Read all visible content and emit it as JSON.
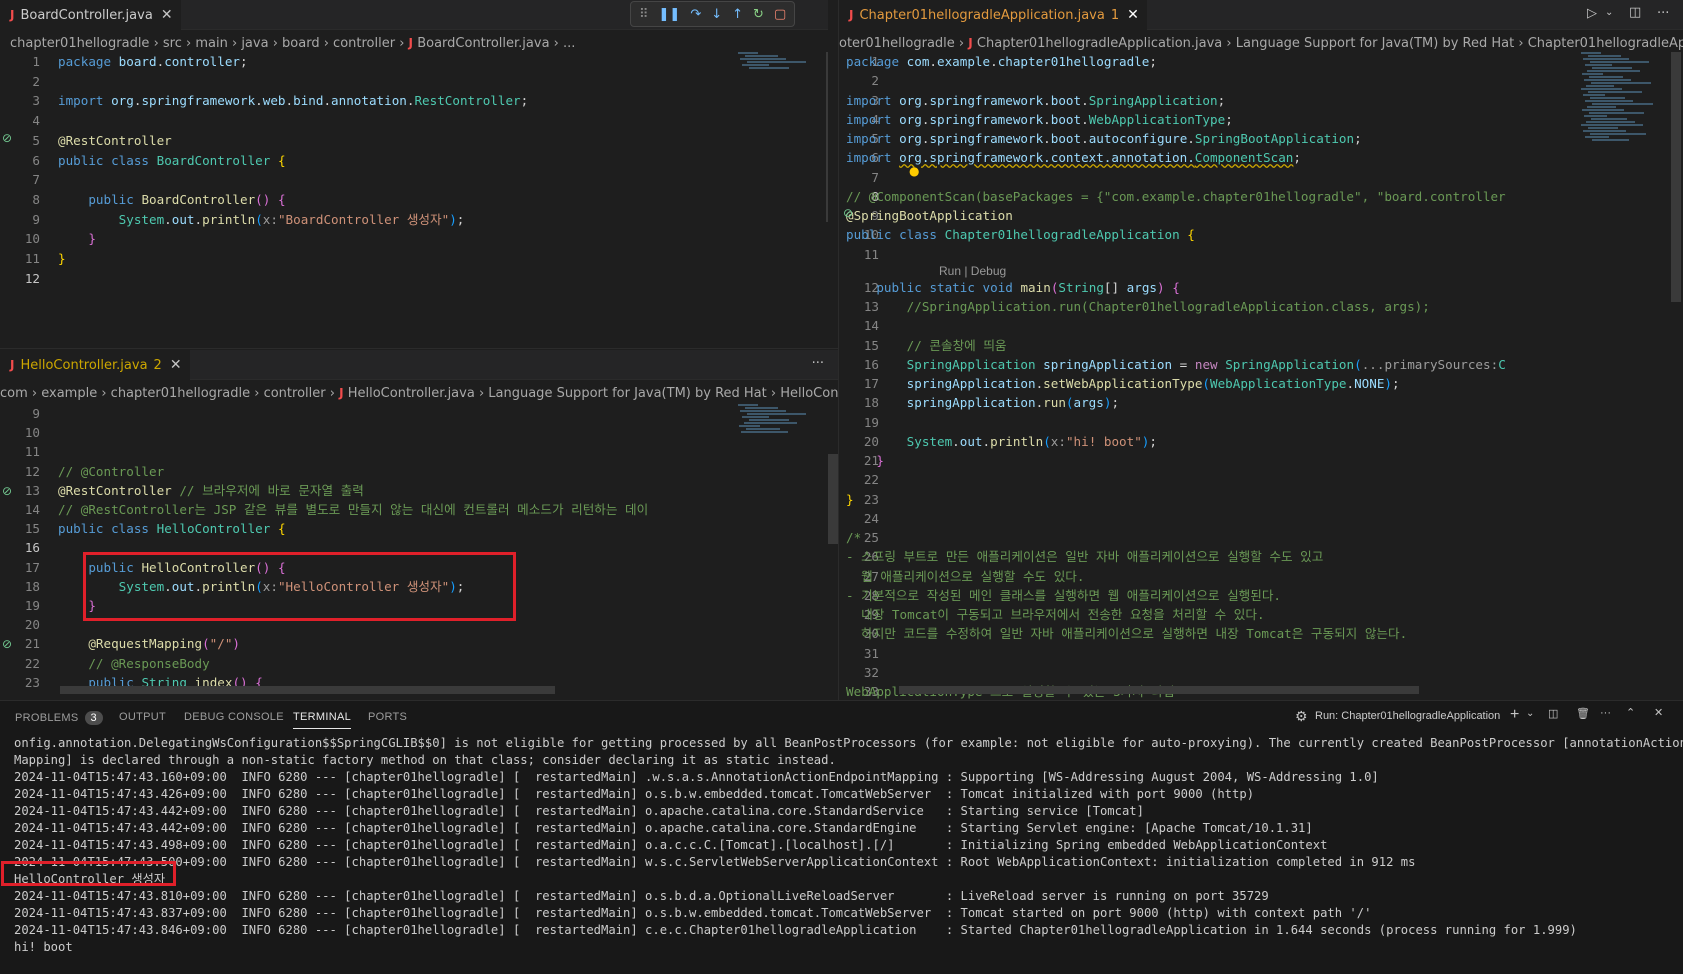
{
  "topLeft": {
    "tab": {
      "name": "BoardController.java",
      "close": "✕"
    },
    "crumbs": [
      "chapter01hellogradle",
      "src",
      "main",
      "java",
      "board",
      "controller",
      "BoardController.java",
      "..."
    ],
    "lines": [
      {
        "n": "1",
        "h": "<span class='k'>package</span> <span class='pk'>board</span><span class='pu'>.</span><span class='pk'>controller</span><span class='pu'>;</span>"
      },
      {
        "n": "2",
        "h": ""
      },
      {
        "n": "3",
        "h": "<span class='k'>import</span> <span class='pk'>org</span><span class='pu'>.</span><span class='pk'>springframework</span><span class='pu'>.</span><span class='pk'>web</span><span class='pu'>.</span><span class='pk'>bind</span><span class='pu'>.</span><span class='pk'>annotation</span><span class='pu'>.</span><span class='ty'>RestController</span><span class='pu'>;</span>"
      },
      {
        "n": "4",
        "h": ""
      },
      {
        "n": "5",
        "h": "<span class='an'>@RestController</span>"
      },
      {
        "n": "6",
        "h": "<span class='k'>public</span> <span class='k'>class</span> <span class='ty'>BoardController</span> <span class='br'>{</span>"
      },
      {
        "n": "7",
        "h": ""
      },
      {
        "n": "8",
        "h": "    <span class='k'>public</span> <span class='fn'>BoardController</span><span class='br2'>()</span> <span class='br2'>{</span>"
      },
      {
        "n": "9",
        "h": "        <span class='ty'>System</span><span class='pu'>.</span><span class='va'>out</span><span class='pu'>.</span><span class='fn'>println</span><span class='br3'>(</span><span class='hint'>x:</span><span class='st'>\"BoardController 생성자\"</span><span class='br3'>)</span><span class='pu'>;</span>"
      },
      {
        "n": "10",
        "h": "    <span class='br2'>}</span>"
      },
      {
        "n": "11",
        "h": "<span class='br'>}</span>"
      },
      {
        "n": "12",
        "h": "",
        "cur": true
      }
    ]
  },
  "bottomLeft": {
    "tab": {
      "name": "HelloController.java",
      "count": "2",
      "close": "✕",
      "more": "···"
    },
    "crumbs": [
      "com",
      "example",
      "chapter01hellogradle",
      "controller",
      "HelloController.java",
      "Language Support for Java(TM) by Red Hat",
      "HelloController"
    ],
    "lines": [
      {
        "n": "9",
        "h": ""
      },
      {
        "n": "10",
        "h": ""
      },
      {
        "n": "11",
        "h": ""
      },
      {
        "n": "12",
        "h": "<span class='cm'>// @Controller</span>"
      },
      {
        "n": "13",
        "h": "<span class='an'>@RestController</span> <span class='cm'>// 브라우저에 바로 문자열 출력</span>"
      },
      {
        "n": "14",
        "h": "<span class='cm'>// @RestController는 JSP 같은 뷰를 별도로 만들지 않는 대신에 컨트롤러 메소드가 리턴하는 데이</span>"
      },
      {
        "n": "15",
        "h": "<span class='k'>public</span> <span class='k'>class</span> <span class='ty'>HelloController</span> <span class='br'>{</span>"
      },
      {
        "n": "16",
        "h": "",
        "cur": true
      },
      {
        "n": "17",
        "h": "    <span class='k'>public</span> <span class='fn'>HelloController</span><span class='br2'>()</span> <span class='br2'>{</span>"
      },
      {
        "n": "18",
        "h": "        <span class='ty'>System</span><span class='pu'>.</span><span class='va'>out</span><span class='pu'>.</span><span class='fn'>println</span><span class='br3'>(</span><span class='hint'>x:</span><span class='st'>\"HelloController 생성자\"</span><span class='br3'>)</span><span class='pu'>;</span>"
      },
      {
        "n": "19",
        "h": "    <span class='br2'>}</span>"
      },
      {
        "n": "20",
        "h": ""
      },
      {
        "n": "21",
        "h": "    <span class='an'>@RequestMapping</span><span class='br2'>(</span><span class='st'>\"/\"</span><span class='br2'>)</span>"
      },
      {
        "n": "22",
        "h": "    <span class='cm'>// @ResponseBody</span>"
      },
      {
        "n": "23",
        "h": "    <span class='k'>public</span> <span class='ty'>String</span> <span class='fn'>index</span><span class='br2'>()</span> <span class='br2'>{</span>"
      }
    ]
  },
  "right": {
    "tab": {
      "name": "Chapter01hellogradleApplication.java",
      "count": "1",
      "close": "✕"
    },
    "crumbs": [
      "oter01hellogradle",
      "Chapter01hellogradleApplication.java",
      "Language Support for Java(TM) by Red Hat",
      "Chapter01hellogradleApplication"
    ],
    "codelens": "Run | Debug",
    "lines": [
      {
        "n": "1",
        "h": "<span class='k'>package</span> <span class='pk'>com</span><span class='pu'>.</span><span class='pk'>example</span><span class='pu'>.</span><span class='pk'>chapter01hellogradle</span><span class='pu'>;</span>"
      },
      {
        "n": "2",
        "h": ""
      },
      {
        "n": "3",
        "h": "<span class='k'>import</span> <span class='pk'>org</span><span class='pu'>.</span><span class='pk'>springframework</span><span class='pu'>.</span><span class='pk'>boot</span><span class='pu'>.</span><span class='ty'>SpringApplication</span><span class='pu'>;</span>"
      },
      {
        "n": "4",
        "h": "<span class='k'>import</span> <span class='pk'>org</span><span class='pu'>.</span><span class='pk'>springframework</span><span class='pu'>.</span><span class='pk'>boot</span><span class='pu'>.</span><span class='ty'>WebApplicationType</span><span class='pu'>;</span>"
      },
      {
        "n": "5",
        "h": "<span class='k'>import</span> <span class='pk'>org</span><span class='pu'>.</span><span class='pk'>springframework</span><span class='pu'>.</span><span class='pk'>boot</span><span class='pu'>.</span><span class='pk'>autoconfigure</span><span class='pu'>.</span><span class='ty'>SpringBootApplication</span><span class='pu'>;</span>"
      },
      {
        "n": "6",
        "h": "<span class='k'>import</span> <span class='pk' style='text-decoration:underline wavy #cca700'>org.springframework.context.annotation.</span><span class='ty' style='text-decoration:underline wavy #cca700'>ComponentScan</span><span class='pu'>;</span>"
      },
      {
        "n": "7",
        "h": ""
      },
      {
        "n": "8",
        "h": "<span class='cm'>// @ComponentScan(basePackages = {\"com.example.chapter01hellogradle\", \"board.controller</span>",
        "cur": true
      },
      {
        "n": "9",
        "h": "<span class='an'>@SpringBootApplication</span>"
      },
      {
        "n": "10",
        "h": "<span class='k'>public</span> <span class='k'>class</span> <span class='ty'>Chapter01hellogradleApplication</span> <span class='br'>{</span>"
      },
      {
        "n": "11",
        "h": ""
      },
      {
        "n": "12",
        "h": "    <span class='k'>public</span> <span class='k'>static</span> <span class='k'>void</span> <span class='fn'>main</span><span class='br2'>(</span><span class='ty'>String</span><span class='pu'>[]</span> <span class='va'>args</span><span class='br2'>)</span> <span class='br2'>{</span>"
      },
      {
        "n": "13",
        "h": "        <span class='cm'>//SpringApplication.run(Chapter01hellogradleApplication.class, args);</span>"
      },
      {
        "n": "14",
        "h": ""
      },
      {
        "n": "15",
        "h": "        <span class='cm'>// 콘솔창에 띄움</span>"
      },
      {
        "n": "16",
        "h": "        <span class='ty'>SpringApplication</span> <span class='va'>springApplication</span> <span class='pu'>=</span> <span class='kc'>new</span> <span class='ty'>SpringApplication</span><span class='br3'>(</span><span class='hint'>...primarySources:</span><span class='ty'>C</span>"
      },
      {
        "n": "17",
        "h": "        <span class='va'>springApplication</span><span class='pu'>.</span><span class='fn'>setWebApplicationType</span><span class='br3'>(</span><span class='ty'>WebApplicationType</span><span class='pu'>.</span><span class='va'>NONE</span><span class='br3'>)</span><span class='pu'>;</span>"
      },
      {
        "n": "18",
        "h": "        <span class='va'>springApplication</span><span class='pu'>.</span><span class='fn'>run</span><span class='br3'>(</span><span class='va'>args</span><span class='br3'>)</span><span class='pu'>;</span>"
      },
      {
        "n": "19",
        "h": ""
      },
      {
        "n": "20",
        "h": "        <span class='ty'>System</span><span class='pu'>.</span><span class='va'>out</span><span class='pu'>.</span><span class='fn'>println</span><span class='br3'>(</span><span class='hint'>x:</span><span class='st'>\"hi! boot\"</span><span class='br3'>)</span><span class='pu'>;</span>"
      },
      {
        "n": "21",
        "h": "    <span class='br2'>}</span>"
      },
      {
        "n": "22",
        "h": ""
      },
      {
        "n": "23",
        "h": "<span class='br'>}</span>"
      },
      {
        "n": "24",
        "h": ""
      },
      {
        "n": "25",
        "h": "<span class='cm'>/*</span>"
      },
      {
        "n": "26",
        "h": "<span class='cm'>- 스프링 부트로 만든 애플리케이션은 일반 자바 애플리케이션으로 실행할 수도 있고</span>"
      },
      {
        "n": "27",
        "h": "<span class='cm'>  웹 애플리케이션으로 실행할 수도 있다.</span>"
      },
      {
        "n": "28",
        "h": "<span class='cm'>- 기본적으로 작성된 메인 클래스를 실행하면 웹 애플리케이션으로 실행된다.</span>"
      },
      {
        "n": "29",
        "h": "<span class='cm'>  내장 Tomcat이 구동되고 브라우저에서 전송한 요청을 처리할 수 있다.</span>"
      },
      {
        "n": "30",
        "h": "<span class='cm'>  하지만 코드를 수정하여 일반 자바 애플리케이션으로 실행하면 내장 Tomcat은 구동되지 않는다.</span>"
      },
      {
        "n": "31",
        "h": ""
      },
      {
        "n": "32",
        "h": ""
      },
      {
        "n": "33",
        "h": "<span class='cm'>WebApplicationType 으로 설정할 수 있는 3가지 타입</span>"
      }
    ]
  },
  "panel": {
    "tabs": {
      "problems": "PROBLEMS",
      "problemsCount": "3",
      "output": "OUTPUT",
      "debug": "DEBUG CONSOLE",
      "terminal": "TERMINAL",
      "ports": "PORTS"
    },
    "runLabel": "Run: Chapter01hellogradleApplication",
    "terminal": [
      "onfig.annotation.DelegatingWsConfiguration$$SpringCGLIB$$0] is not eligible for getting processed by all BeanPostProcessors (for example: not eligible for auto-proxying). The currently created BeanPostProcessor [annotationActionEndpoint",
      "Mapping] is declared through a non-static factory method on that class; consider declaring it as static instead.",
      "2024-11-04T15:47:43.160+09:00  INFO 6280 --- [chapter01hellogradle] [  restartedMain] .w.s.a.s.AnnotationActionEndpointMapping : Supporting [WS-Addressing August 2004, WS-Addressing 1.0]",
      "2024-11-04T15:47:43.426+09:00  INFO 6280 --- [chapter01hellogradle] [  restartedMain] o.s.b.w.embedded.tomcat.TomcatWebServer  : Tomcat initialized with port 9000 (http)",
      "2024-11-04T15:47:43.442+09:00  INFO 6280 --- [chapter01hellogradle] [  restartedMain] o.apache.catalina.core.StandardService   : Starting service [Tomcat]",
      "2024-11-04T15:47:43.442+09:00  INFO 6280 --- [chapter01hellogradle] [  restartedMain] o.apache.catalina.core.StandardEngine    : Starting Servlet engine: [Apache Tomcat/10.1.31]",
      "2024-11-04T15:47:43.498+09:00  INFO 6280 --- [chapter01hellogradle] [  restartedMain] o.a.c.c.C.[Tomcat].[localhost].[/]       : Initializing Spring embedded WebApplicationContext",
      "2024-11-04T15:47:43.500+09:00  INFO 6280 --- [chapter01hellogradle] [  restartedMain] w.s.c.ServletWebServerApplicationContext : Root WebApplicationContext: initialization completed in 912 ms",
      "HelloController 생성자",
      "2024-11-04T15:47:43.810+09:00  INFO 6280 --- [chapter01hellogradle] [  restartedMain] o.s.b.d.a.OptionalLiveReloadServer       : LiveReload server is running on port 35729",
      "2024-11-04T15:47:43.837+09:00  INFO 6280 --- [chapter01hellogradle] [  restartedMain] o.s.b.w.embedded.tomcat.TomcatWebServer  : Tomcat started on port 9000 (http) with context path '/'",
      "2024-11-04T15:47:43.846+09:00  INFO 6280 --- [chapter01hellogradle] [  restartedMain] c.e.c.Chapter01hellogradleApplication    : Started Chapter01hellogradleApplication in 1.644 seconds (process running for 1.999)",
      "hi! boot"
    ]
  },
  "colors": {
    "highlight": "#e0202a",
    "background": "#1e1e1e",
    "panel": "#181818"
  }
}
